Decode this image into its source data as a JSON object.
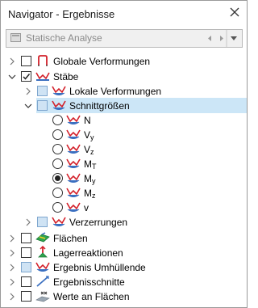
{
  "window": {
    "title": "Navigator - Ergebnisse"
  },
  "combo": {
    "label": "Statische Analyse"
  },
  "tree": {
    "globale": "Globale Verformungen",
    "staebe": "Stäbe",
    "lokale": "Lokale Verformungen",
    "schnitt": "Schnittgrößen",
    "radios": [
      {
        "main": "N",
        "sub": "",
        "selected": false
      },
      {
        "main": "V",
        "sub": "y",
        "selected": false
      },
      {
        "main": "V",
        "sub": "z",
        "selected": false
      },
      {
        "main": "M",
        "sub": "T",
        "selected": false
      },
      {
        "main": "M",
        "sub": "y",
        "selected": true
      },
      {
        "main": "M",
        "sub": "z",
        "selected": false
      },
      {
        "main": "v",
        "sub": "",
        "selected": false
      }
    ],
    "verzerrungen": "Verzerrungen",
    "flaechen": "Flächen",
    "lager": "Lagerreaktionen",
    "umhuellende": "Ergebnis Umhüllende",
    "schnitte": "Ergebnisschnitte",
    "werte": "Werte an Flächen"
  },
  "colors": {
    "accent": "#0a5fb4",
    "member_red": "#d3202a",
    "member_blue": "#3a6fc0",
    "highlight": "#cce6f7"
  }
}
